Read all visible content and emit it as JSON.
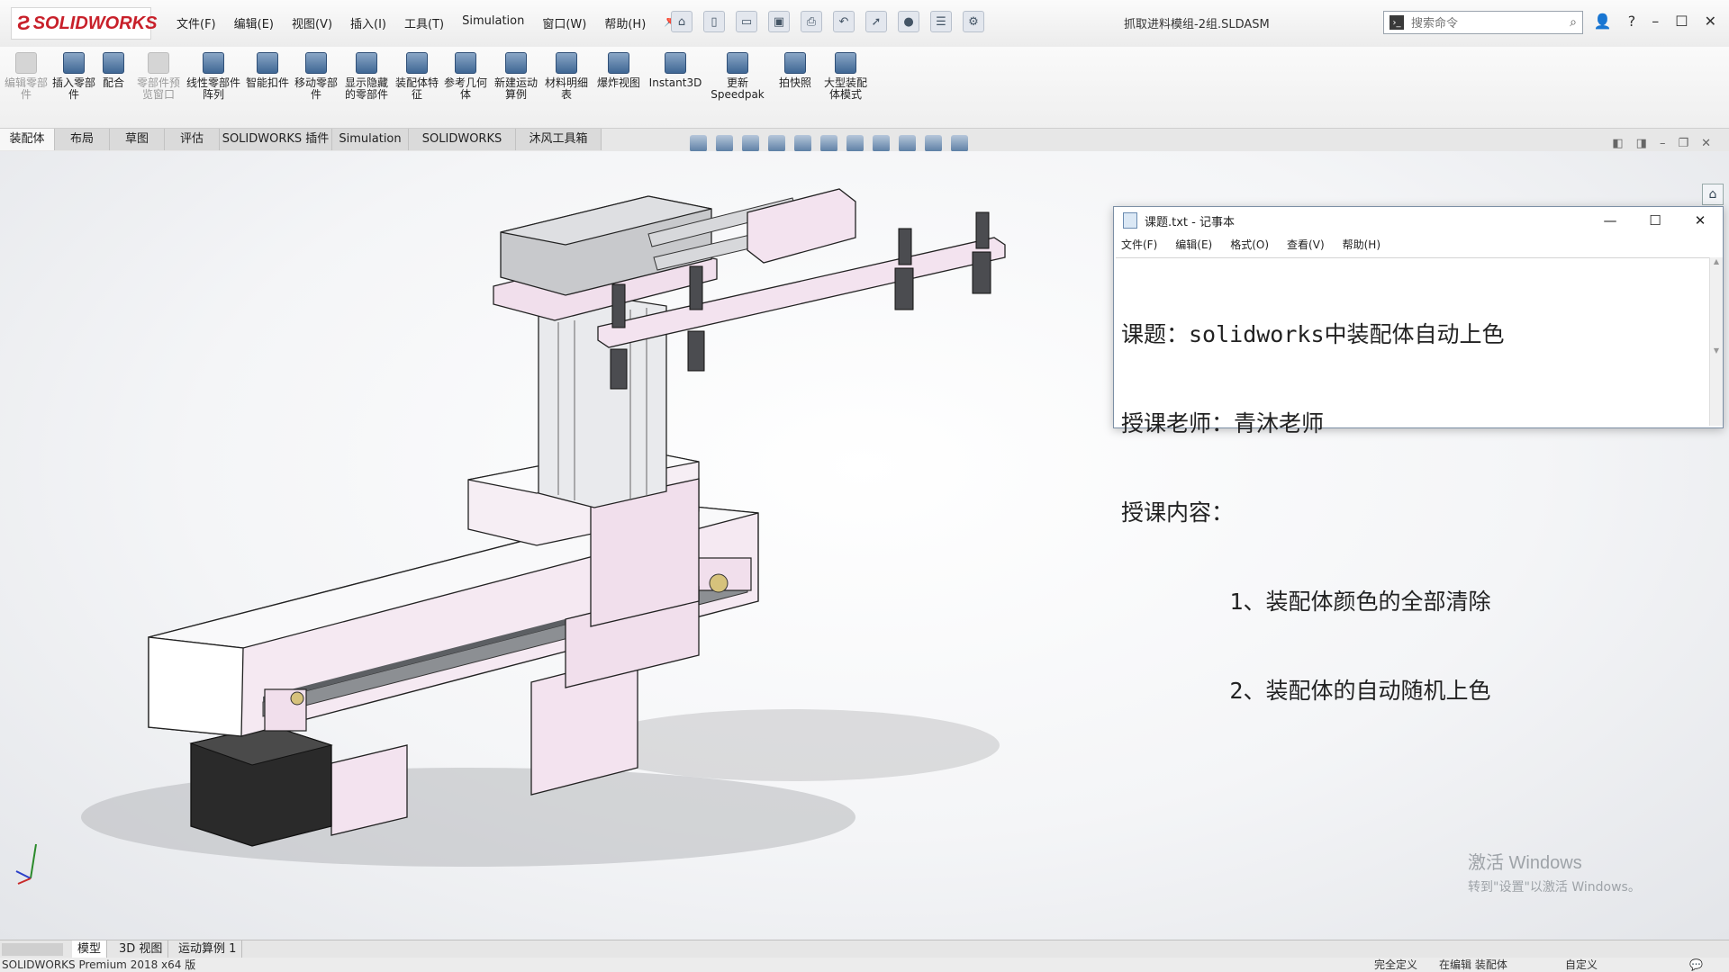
{
  "app": {
    "brand": "SOLIDWORKS",
    "document_title": "抓取进料模组-2组.SLDASM",
    "menu": [
      "文件(F)",
      "编辑(E)",
      "视图(V)",
      "插入(I)",
      "工具(T)",
      "Simulation",
      "窗口(W)",
      "帮助(H)"
    ],
    "search_placeholder": "搜索命令"
  },
  "command_manager": {
    "buttons": [
      {
        "label": "编辑零部件",
        "state": "disabled"
      },
      {
        "label": "插入零部件",
        "state": "enabled"
      },
      {
        "label": "配合",
        "state": "enabled"
      },
      {
        "label": "零部件预览窗口",
        "state": "disabled"
      },
      {
        "label": "线性零部件阵列",
        "state": "enabled"
      },
      {
        "label": "智能扣件",
        "state": "enabled"
      },
      {
        "label": "移动零部件",
        "state": "enabled"
      },
      {
        "label": "显示隐藏的零部件",
        "state": "enabled"
      },
      {
        "label": "装配体特征",
        "state": "enabled"
      },
      {
        "label": "参考几何体",
        "state": "enabled"
      },
      {
        "label": "新建运动算例",
        "state": "enabled"
      },
      {
        "label": "材料明细表",
        "state": "enabled"
      },
      {
        "label": "爆炸视图",
        "state": "enabled"
      },
      {
        "label": "Instant3D",
        "state": "enabled"
      },
      {
        "label": "更新Speedpak",
        "state": "enabled"
      },
      {
        "label": "拍快照",
        "state": "enabled"
      },
      {
        "label": "大型装配体模式",
        "state": "enabled"
      }
    ]
  },
  "tabs": [
    "装配体",
    "布局",
    "草图",
    "评估",
    "SOLIDWORKS 插件",
    "Simulation",
    "SOLIDWORKS MBD",
    "沐风工具箱"
  ],
  "notepad": {
    "title": "课题.txt - 记事本",
    "menu": [
      "文件(F)",
      "编辑(E)",
      "格式(O)",
      "查看(V)",
      "帮助(H)"
    ],
    "lines": [
      "课题：solidworks中装配体自动上色",
      "授课老师：青沐老师",
      "授课内容：",
      "        1、装配体颜色的全部清除",
      "        2、装配体的自动随机上色"
    ]
  },
  "model_tabs": [
    "模型",
    "3D 视图",
    "运动算例 1"
  ],
  "status": {
    "product": "SOLIDWORKS Premium 2018 x64 版",
    "fully_defined": "完全定义",
    "editing": "在编辑 装配体",
    "custom": "自定义"
  },
  "watermark": {
    "line1": "激活 Windows",
    "line2": "转到\"设置\"以激活 Windows。"
  },
  "colors": {
    "brand_red": "#c8202a",
    "part_pink": "#f1dfec",
    "part_gray": "#c8c9cc",
    "motor_black": "#2a2a2a"
  }
}
